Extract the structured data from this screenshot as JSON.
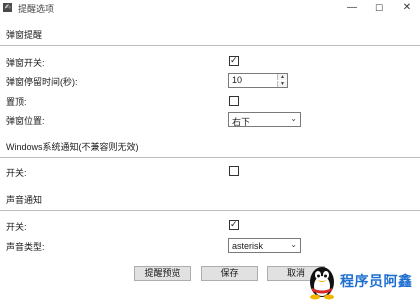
{
  "window": {
    "icon_text": "✍",
    "title": "提醒选项",
    "minimize": "—",
    "maximize": "☐",
    "close": "✕"
  },
  "popup_section": {
    "title": "弹窗提醒",
    "toggle_label": "弹窗开关:",
    "toggle_checked": true,
    "stay_label": "弹窗停留时间(秒):",
    "stay_value": "10",
    "pin_label": "置顶:",
    "pin_checked": false,
    "position_label": "弹窗位置:",
    "position_value": "右下"
  },
  "windows_section": {
    "title": "Windows系统通知(不兼容则无效)",
    "toggle_label": "开关:",
    "toggle_checked": false
  },
  "sound_section": {
    "title": "声音通知",
    "toggle_label": "开关:",
    "toggle_checked": true,
    "type_label": "声音类型:",
    "type_value": "asterisk"
  },
  "buttons": {
    "preview": "提醒预览",
    "save": "保存",
    "cancel": "取消"
  },
  "watermark": {
    "text": "程序员阿鑫",
    "icon": "penguin-icon",
    "color": "#1e6fd0"
  },
  "icons": {
    "check": "✓",
    "spin_up": "▲",
    "spin_down": "▼",
    "dropdown": "⌄"
  }
}
